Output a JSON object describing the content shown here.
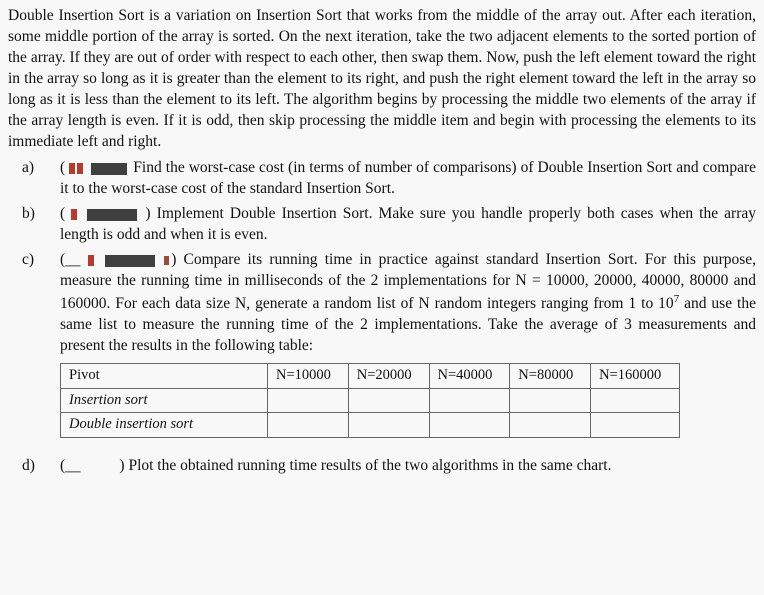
{
  "intro": "Double Insertion Sort is a variation on Insertion Sort that works from the middle of the array out. After each iteration, some middle portion of the array is sorted. On the next iteration, take the two adjacent elements to the sorted portion of the array. If they are out of order with respect to each other, then swap them. Now, push the left element toward the right in the array so long as it is greater than the element to its right, and push the right element toward the left in the array so long as it is less than the element to its left. The algorithm begins by processing the middle two elements of the array if the array length is even. If it is odd, then skip processing the middle item and begin with processing the elements to its immediate left and right.",
  "items": {
    "a": {
      "label": "a)",
      "text_after": "Find the worst-case cost (in terms of number of comparisons) of Double Insertion Sort and compare it to the worst-case cost of the standard Insertion Sort."
    },
    "b": {
      "label": "b)",
      "text_after": "Implement Double Insertion Sort. Make sure you handle properly both cases when the array length is odd and when it is even."
    },
    "c": {
      "label": "c)",
      "line1_after": ") Compare its running time in practice against standard Insertion Sort. For this",
      "line_rest": "purpose, measure the running time in milliseconds of the 2 implementations for N = 10000, 20000, 40000, 80000 and 160000. For each data size N, generate a random list of N random integers ranging from 1 to 10",
      "power": "7",
      "line_rest2": " and use the same list to measure the running time of the 2 implementations. Take the average of 3 measurements and present the results in the following table:"
    },
    "d": {
      "label": "d)",
      "text_after": "Plot the obtained running time results of the two algorithms in the same chart."
    }
  },
  "table": {
    "headers": [
      "Pivot",
      "N=10000",
      "N=20000",
      "N=40000",
      "N=80000",
      "N=160000"
    ],
    "rows": [
      "Insertion sort",
      "Double insertion sort"
    ]
  }
}
